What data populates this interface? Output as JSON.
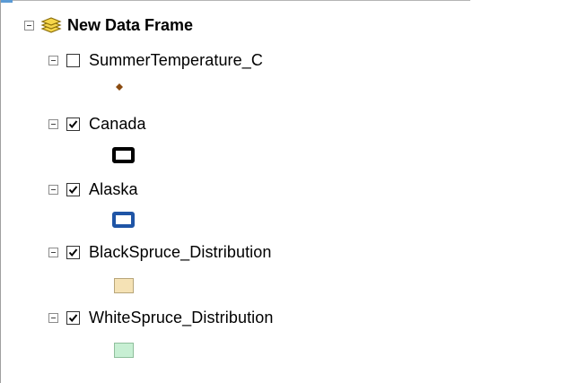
{
  "toc": {
    "data_frame": {
      "label": "New Data Frame",
      "icon": "layers-icon",
      "expanded": true
    },
    "layers": [
      {
        "label": "SummerTemperature_C",
        "checked": false,
        "symbol": "point",
        "symbol_color": "#8a4b10"
      },
      {
        "label": "Canada",
        "checked": true,
        "symbol": "hollow-rectangle",
        "symbol_color": "#000000"
      },
      {
        "label": "Alaska",
        "checked": true,
        "symbol": "hollow-rectangle",
        "symbol_color": "#1f55a6"
      },
      {
        "label": "BlackSpruce_Distribution",
        "checked": true,
        "symbol": "fill",
        "symbol_color": "#f5e2b5"
      },
      {
        "label": "WhiteSpruce_Distribution",
        "checked": true,
        "symbol": "fill",
        "symbol_color": "#c7efd3"
      }
    ]
  }
}
